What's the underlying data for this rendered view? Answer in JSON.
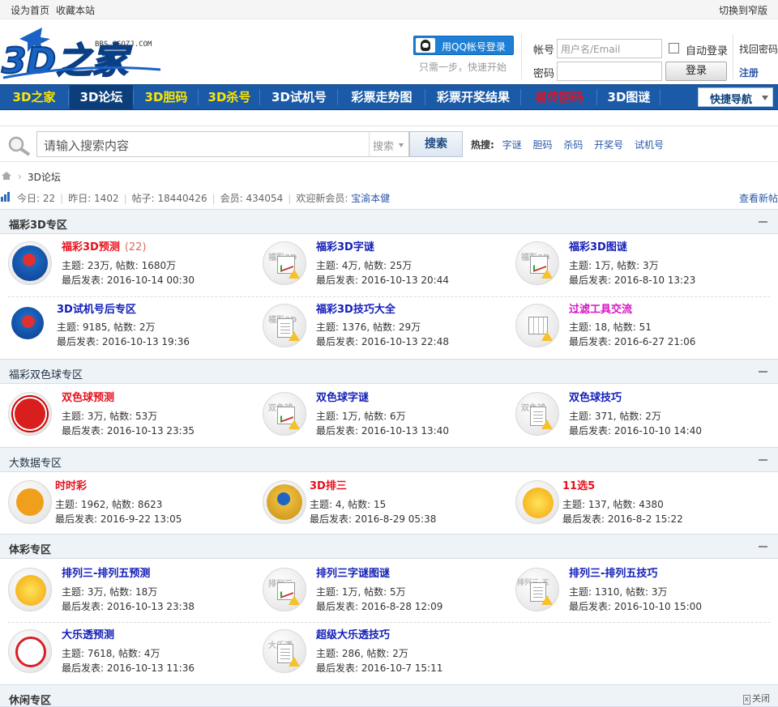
{
  "topbar": {
    "set_home": "设为首页",
    "favorite": "收藏本站",
    "switch_width": "切换到窄版"
  },
  "header": {
    "logo_text": "3D之家",
    "logo_url": "BBS.SSQZJ.COM",
    "qq_login": "用QQ帐号登录",
    "qq_tip": "只需一步，快速开始",
    "account_label": "帐号",
    "account_placeholder": "用户名/Email",
    "password_label": "密码",
    "auto_login": "自动登录",
    "login_button": "登录",
    "find_password": "找回密码",
    "register": "注册"
  },
  "nav": {
    "items": [
      "3D之家",
      "3D论坛",
      "3D胆码",
      "3D杀号",
      "3D试机号",
      "彩票走势图",
      "彩票开奖结果",
      "易传胆码",
      "3D图谜"
    ],
    "colors": [
      "#ffe600",
      "#ffffff",
      "#ffe600",
      "#ffe600",
      "#ffffff",
      "#ffffff",
      "#ffffff",
      "#e8101c",
      "#ffffff"
    ],
    "active": "3D论坛",
    "quick_nav": "快捷导航"
  },
  "search": {
    "placeholder": "请输入搜索内容",
    "select": "搜索",
    "button": "搜索",
    "hot_label": "热搜:",
    "hot": [
      "字谜",
      "胆码",
      "杀码",
      "开奖号",
      "试机号"
    ]
  },
  "breadcrumb": {
    "current": "3D论坛"
  },
  "stats": {
    "today": "今日: 22",
    "yesterday": "昨日: 1402",
    "posts": "帖子: 18440426",
    "members": "会员: 434054",
    "welcome": "欢迎新会员:",
    "new_member": "宝渝本健",
    "view_new": "查看新帖"
  },
  "sections": [
    {
      "title": "福彩3D专区",
      "forums": [
        {
          "name": "福彩3D预测",
          "count": "(22)",
          "topics": "主题: 23万, 帖数: 1680万",
          "last": "最后发表: 2016-10-14 00:30"
        },
        {
          "name": "福彩3D字谜",
          "topics": "主题: 4万, 帖数: 25万",
          "last": "最后发表: 2016-10-13 20:44"
        },
        {
          "name": "福彩3D图谜",
          "topics": "主题: 1万, 帖数: 3万",
          "last": "最后发表: 2016-8-10 13:23"
        },
        {
          "name": "3D试机号后专区",
          "topics": "主题: 9185, 帖数: 2万",
          "last": "最后发表: 2016-10-13 19:36"
        },
        {
          "name": "福彩3D技巧大全",
          "topics": "主题: 1376, 帖数: 29万",
          "last": "最后发表: 2016-10-13 22:48"
        },
        {
          "name": "过滤工具交流",
          "topics": "主题: 18, 帖数: 51",
          "last": "最后发表: 2016-6-27 21:06"
        }
      ]
    },
    {
      "title": "福彩双色球专区",
      "forums": [
        {
          "name": "双色球预测",
          "topics": "主题: 3万, 帖数: 53万",
          "last": "最后发表: 2016-10-13 23:35"
        },
        {
          "name": "双色球字谜",
          "topics": "主题: 1万, 帖数: 6万",
          "last": "最后发表: 2016-10-13 13:40"
        },
        {
          "name": "双色球技巧",
          "topics": "主题: 371, 帖数: 2万",
          "last": "最后发表: 2016-10-10 14:40"
        }
      ]
    },
    {
      "title": "大数据专区",
      "forums": [
        {
          "name": "时时彩",
          "topics": "主题: 1962, 帖数: 8623",
          "last": "最后发表: 2016-9-22 13:05"
        },
        {
          "name": "3D排三",
          "topics": "主题: 4, 帖数: 15",
          "last": "最后发表: 2016-8-29 05:38"
        },
        {
          "name": "11选5",
          "topics": "主题: 137, 帖数: 4380",
          "last": "最后发表: 2016-8-2 15:22"
        }
      ]
    },
    {
      "title": "体彩专区",
      "forums": [
        {
          "name": "排列三-排列五预测",
          "topics": "主题: 3万, 帖数: 18万",
          "last": "最后发表: 2016-10-13 23:38"
        },
        {
          "name": "排列三字谜图谜",
          "topics": "主题: 1万, 帖数: 5万",
          "last": "最后发表: 2016-8-28 12:09"
        },
        {
          "name": "排列三-排列五技巧",
          "topics": "主题: 1310, 帖数: 3万",
          "last": "最后发表: 2016-10-10 15:00"
        },
        {
          "name": "大乐透预测",
          "topics": "主题: 7618, 帖数: 4万",
          "last": "最后发表: 2016-10-13 11:36"
        },
        {
          "name": "超级大乐透技巧",
          "topics": "主题: 286, 帖数: 2万",
          "last": "最后发表: 2016-10-7 15:11"
        }
      ]
    },
    {
      "title": "休闲专区",
      "close": "关闭"
    }
  ],
  "icon_tags": {
    "fc3d": "福彩3D",
    "ssq": "双色球",
    "pl3": "排列三",
    "pl35": "排列三-五",
    "dlt": "大乐透"
  }
}
